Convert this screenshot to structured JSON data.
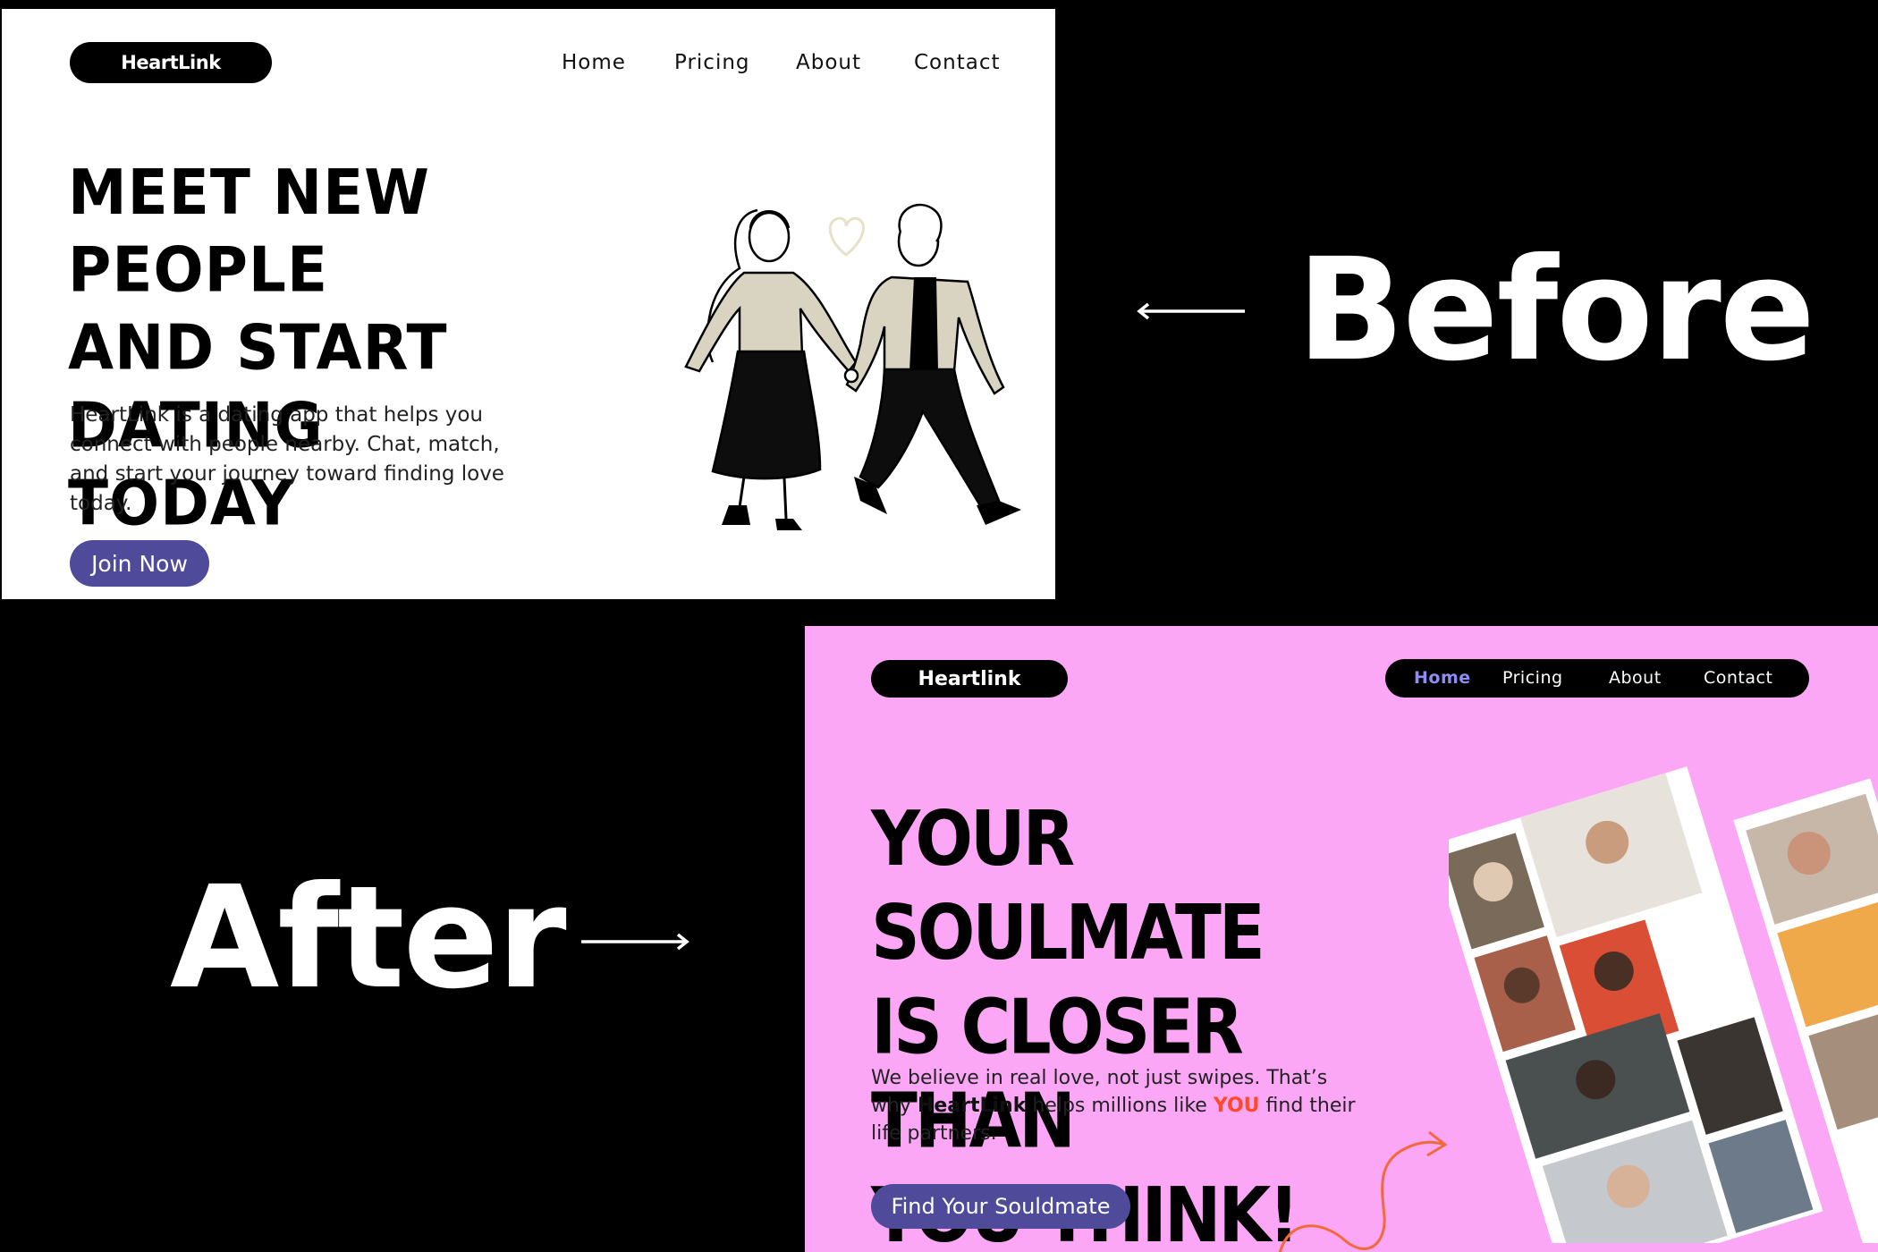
{
  "before": {
    "label": "Before",
    "logo": "HeartLink",
    "nav": [
      "Home",
      "Pricing",
      "About",
      "Contact"
    ],
    "headline": [
      "Meet new people",
      "and start dating",
      "today"
    ],
    "description": "HeartLink is a dating app that helps you connect with people nearby. Chat, match, and start your journey toward finding love today.",
    "cta": "Join Now",
    "colors": {
      "background": "#ffffff",
      "button": "#4f4b9a"
    }
  },
  "after": {
    "label": "After",
    "logo": "Heartlink",
    "nav": [
      "Home",
      "Pricing",
      "About",
      "Contact"
    ],
    "nav_active": "Home",
    "headline": [
      "Your soulmate",
      "is closer than",
      "you think!"
    ],
    "description": {
      "part1": "We believe in real love, not just swipes. That’s why ",
      "brand": "HeartLink",
      "part2": " helps millions like ",
      "highlight": "YOU",
      "part3": " find their life partners."
    },
    "cta": "Find Your Souldmate",
    "colors": {
      "background": "#fca7f6",
      "button": "#4f4b9a",
      "active_nav": "#8f8cf5",
      "highlight": "#ff4a2a",
      "arrow": "#f26a3c"
    }
  }
}
